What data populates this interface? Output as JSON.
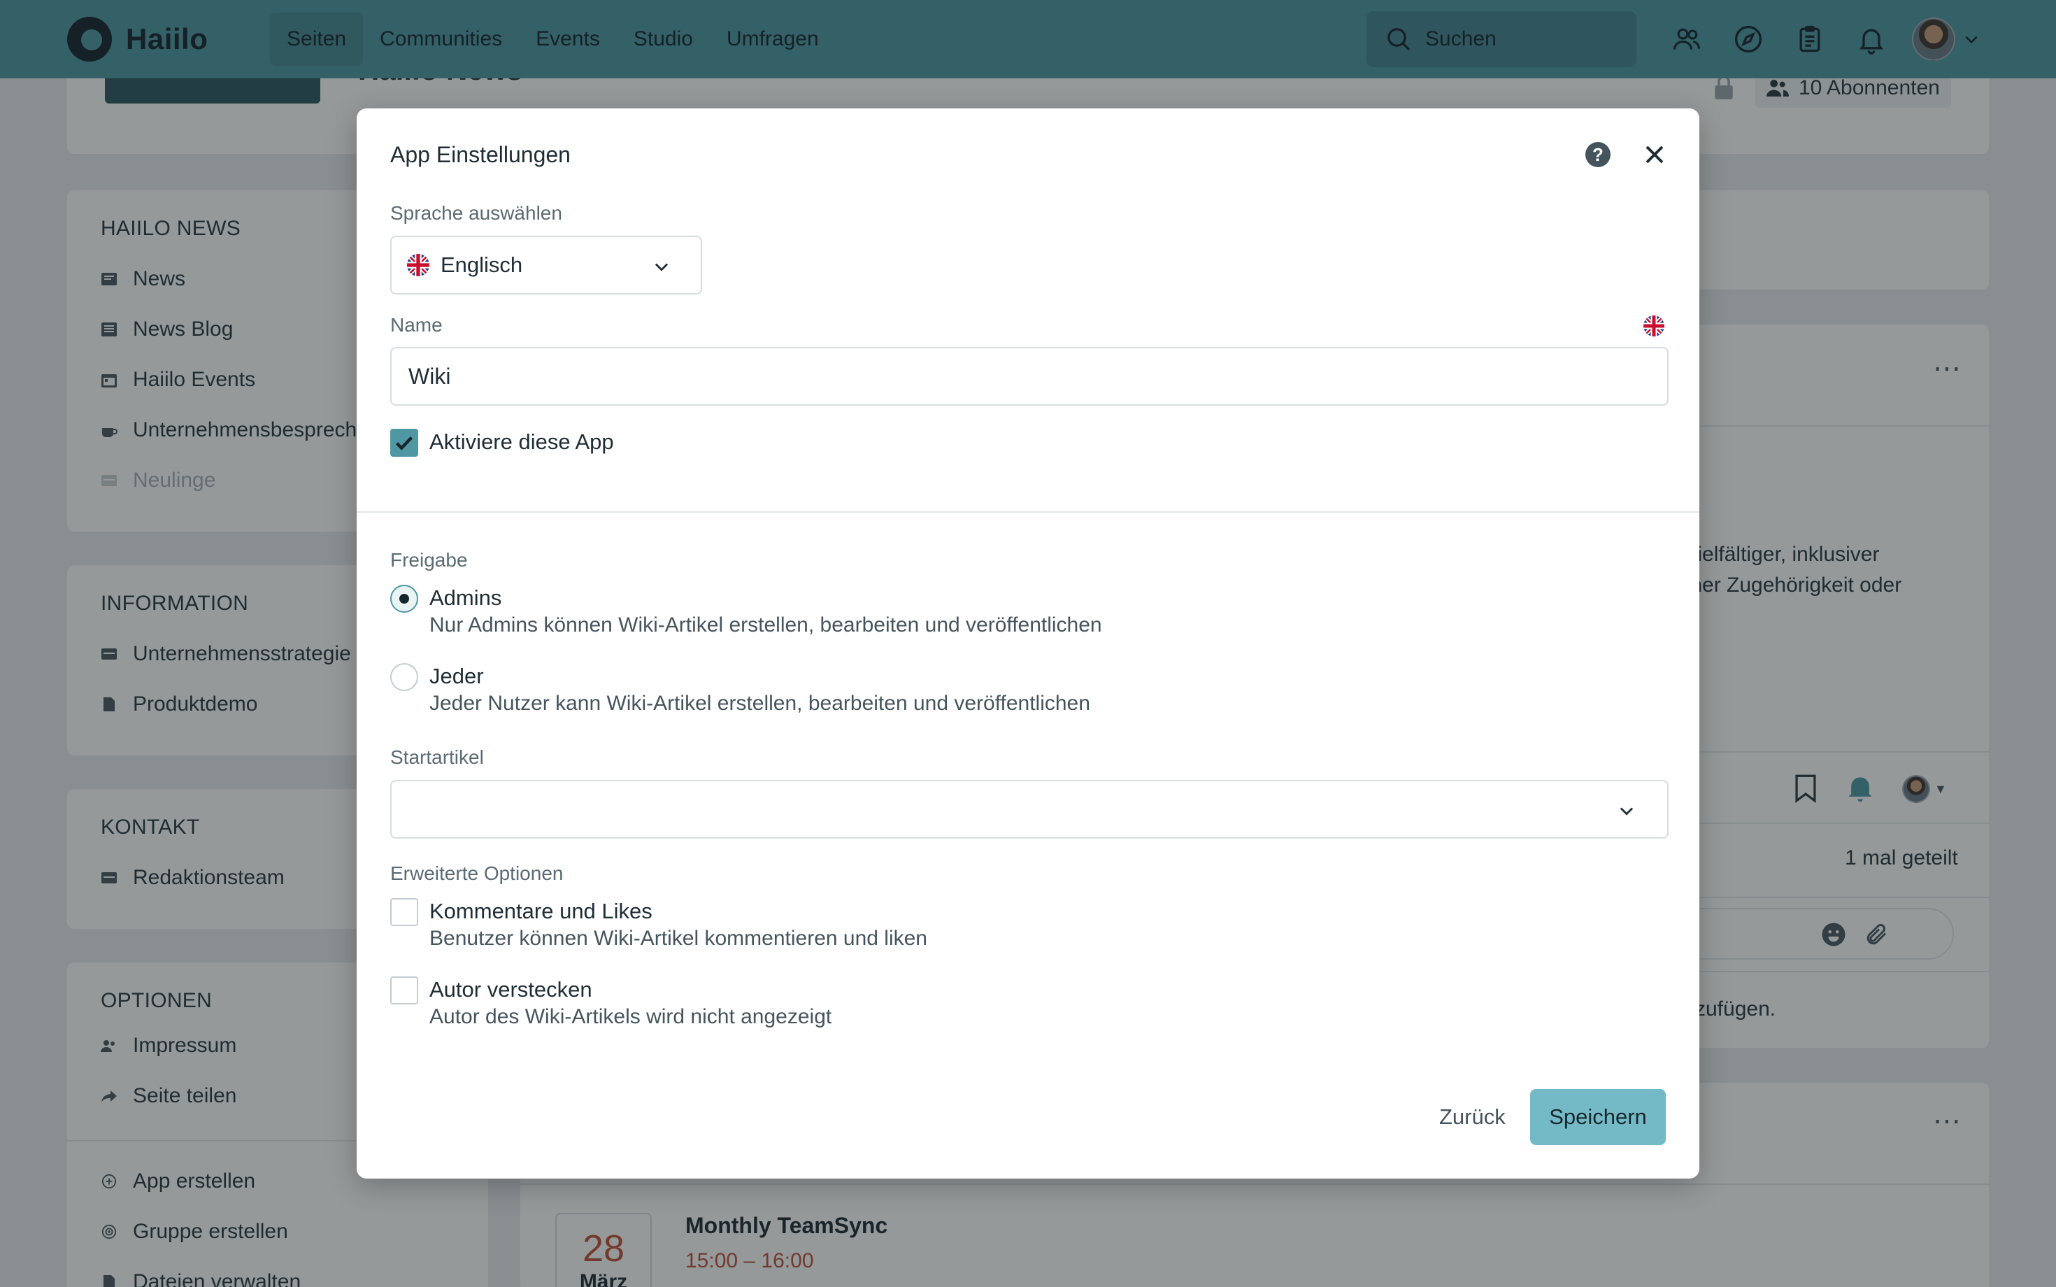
{
  "topnav": {
    "brand": "Haiilo",
    "items": [
      {
        "label": "Seiten",
        "active": true
      },
      {
        "label": "Communities"
      },
      {
        "label": "Events"
      },
      {
        "label": "Studio"
      },
      {
        "label": "Umfragen"
      }
    ],
    "search_label": "Suchen"
  },
  "page": {
    "title": "Haiilo News",
    "subscribers": "10 Abonnenten",
    "sidebar": {
      "sections": [
        {
          "title": "HAIILO NEWS",
          "items": [
            "News",
            "News Blog",
            "Haiilo Events",
            "Unternehmensbesprechung",
            "Neulinge"
          ]
        },
        {
          "title": "INFORMATION",
          "items": [
            "Unternehmensstrategie",
            "Produktdemo"
          ]
        },
        {
          "title": "KONTAKT",
          "items": [
            "Redaktionsteam"
          ]
        },
        {
          "title": "OPTIONEN",
          "items": [
            "Impressum",
            "Seite teilen"
          ]
        }
      ],
      "actions": [
        "App erstellen",
        "Gruppe erstellen",
        "Dateien verwalten"
      ]
    },
    "post_text_line1": "ein vielfältiger, inklusiver",
    "post_text_line2": "nischer Zugehörigkeit oder",
    "shares": "1 mal geteilt",
    "comment_hint": "zufügen.",
    "event": {
      "day": "28",
      "month": "März",
      "title": "Monthly TeamSync",
      "time": "15:00 – 16:00"
    }
  },
  "modal": {
    "title": "App Einstellungen",
    "language_label": "Sprache auswählen",
    "language_value": "Englisch",
    "name_label": "Name",
    "name_value": "Wiki",
    "activate_label": "Aktiviere diese App",
    "activate_checked": true,
    "sharing_label": "Freigabe",
    "sharing_options": [
      {
        "label": "Admins",
        "desc": "Nur Admins können Wiki-Artikel erstellen, bearbeiten und veröffentlichen",
        "selected": true
      },
      {
        "label": "Jeder",
        "desc": "Jeder Nutzer kann Wiki-Artikel erstellen, bearbeiten und veröffentlichen",
        "selected": false
      }
    ],
    "start_article_label": "Startartikel",
    "start_article_value": "",
    "advanced_label": "Erweiterte Optionen",
    "advanced_options": [
      {
        "label": "Kommentare und Likes",
        "desc": "Benutzer können Wiki-Artikel kommentieren und liken",
        "checked": false
      },
      {
        "label": "Autor verstecken",
        "desc": "Autor des Wiki-Artikels wird nicht angezeigt",
        "checked": false
      }
    ],
    "back_label": "Zurück",
    "save_label": "Speichern"
  },
  "colors": {
    "brand": "#4f97a3",
    "primary_button": "#74bac6",
    "event_accent": "#c0533a"
  }
}
